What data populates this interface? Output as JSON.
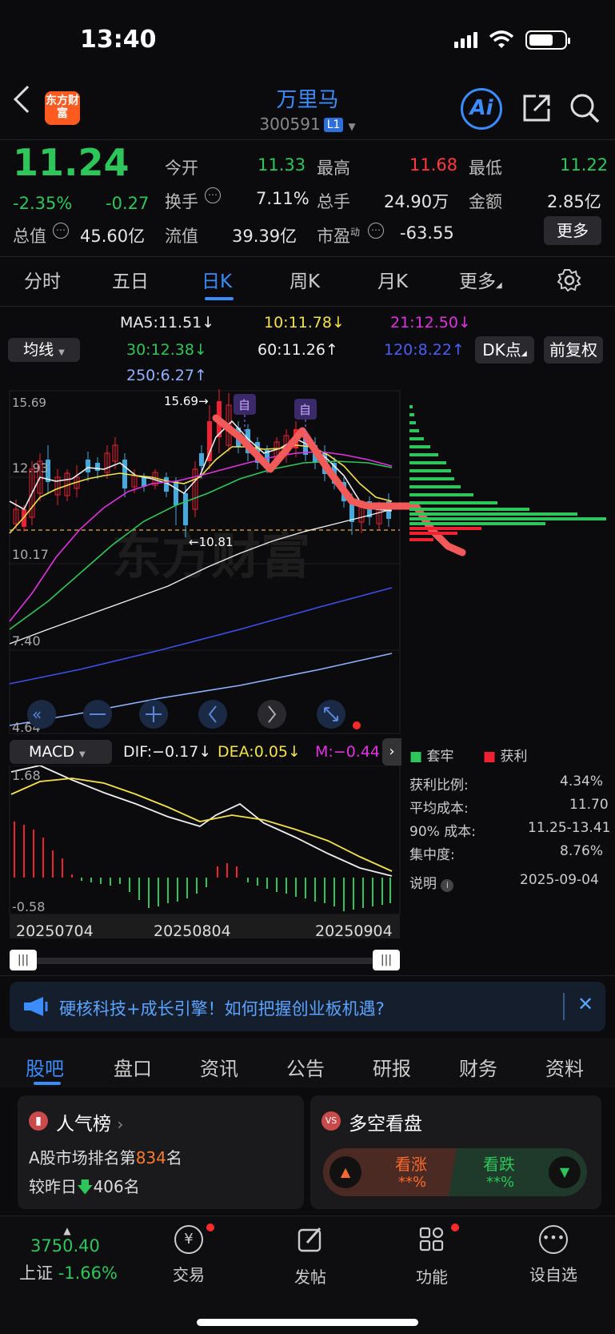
{
  "status_bar": {
    "time": "13:40"
  },
  "header": {
    "logo_text": "东方财富",
    "stock_name": "万里马",
    "stock_code": "300591",
    "level_badge": "L1",
    "ai_label": "Ai"
  },
  "quote": {
    "price": "11.24",
    "change_pct": "-2.35%",
    "change": "-0.27",
    "open_label": "今开",
    "open": "11.33",
    "high_label": "最高",
    "high": "11.68",
    "low_label": "最低",
    "low": "11.22",
    "turnover_label": "换手",
    "turnover": "7.11%",
    "volume_label": "总手",
    "volume": "24.90万",
    "amount_label": "金额",
    "amount": "2.85亿",
    "total_cap_label": "总值",
    "total_cap": "45.60亿",
    "float_cap_label": "流值",
    "float_cap": "39.39亿",
    "pe_label": "市盈",
    "pe_sup": "动",
    "pe": "-63.55",
    "more_button": "更多"
  },
  "period_tabs": [
    "分时",
    "五日",
    "日K",
    "周K",
    "月K",
    "更多"
  ],
  "active_tab": "日K",
  "ma": {
    "selector": "均线",
    "ma5": "MA5:11.51↓",
    "ma10": "10:11.78↓",
    "ma21": "21:12.50↓",
    "ma30": "30:12.38↓",
    "ma60": "60:11.26↑",
    "ma120": "120:8.22↑",
    "ma250": "250:6.27↑",
    "dk_button": "DK点",
    "adjust_button": "前复权"
  },
  "chart": {
    "y_labels": [
      "15.69",
      "12.93",
      "10.17",
      "7.40",
      "4.64"
    ],
    "max_marker": "15.69→",
    "min_marker": "←10.81",
    "flag_label": "自",
    "watermark": "东方财富"
  },
  "macd": {
    "selector": "MACD",
    "dif": "DIF:−0.17↓",
    "dea": "DEA:0.05↓",
    "m": "M:−0.44",
    "y_top": "1.68",
    "y_bottom": "-0.58",
    "dates": [
      "20250704",
      "20250804",
      "20250904"
    ]
  },
  "chips": {
    "legend_trapped": "套牢",
    "legend_profit": "获利",
    "rows": [
      {
        "label": "获利比例:",
        "value": "4.34%"
      },
      {
        "label": "平均成本:",
        "value": "11.70"
      },
      {
        "label": "90% 成本:",
        "value": "11.25-13.41"
      },
      {
        "label": "集中度:",
        "value": "8.76%"
      }
    ],
    "note_label": "说明",
    "date": "2025-09-04"
  },
  "banner": {
    "text": "硬核科技+成长引擎！如何把握创业板机遇?"
  },
  "bottom_tabs": [
    "股吧",
    "盘口",
    "资讯",
    "公告",
    "研报",
    "财务",
    "资料"
  ],
  "popularity": {
    "title": "人气榜",
    "line1_prefix": "A股市场排名第",
    "rank": "834",
    "line1_suffix": "名",
    "line2_prefix": "较昨日",
    "change": "406",
    "line2_suffix": "名"
  },
  "sentiment": {
    "title": "多空看盘",
    "bull_label": "看涨",
    "bull_value": "**%",
    "bear_label": "看跌",
    "bear_value": "**%"
  },
  "bottom_nav": {
    "index_value": "3750.40",
    "index_name": "上证",
    "index_change": "-1.66%",
    "trade": "交易",
    "post": "发帖",
    "functions": "功能",
    "watchlist": "设自选"
  },
  "colors": {
    "up": "#ff3b3b",
    "down": "#2ec65a",
    "accent": "#3a8cff"
  }
}
